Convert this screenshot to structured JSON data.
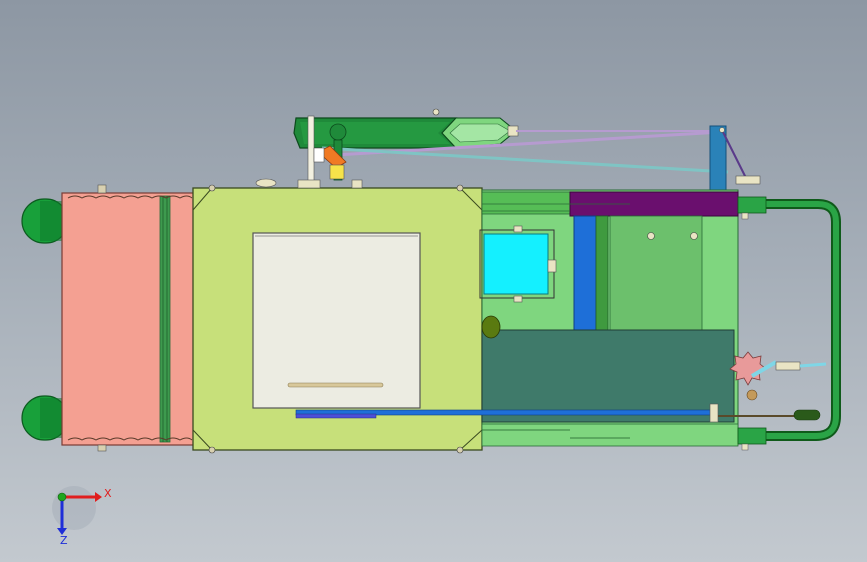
{
  "viewport": {
    "colors": {
      "background_top": "#8d97a3",
      "background_bottom": "#c3c9cf",
      "salmon_tank": "#f4a092",
      "yellow_green_tank": "#c7e07a",
      "dark_green": "#1f8a3a",
      "light_green": "#7fd67f",
      "purple": "#6a0f6e",
      "cyan": "#14f0ff",
      "blue": "#1e6fd8",
      "teal": "#3f7a6a",
      "white_panel": "#ecece2"
    }
  },
  "triad": {
    "x_label": "X",
    "z_label": "Z",
    "x_color": "#e01e1e",
    "z_color": "#1e2ed8",
    "y_color": "#1ea61e"
  }
}
